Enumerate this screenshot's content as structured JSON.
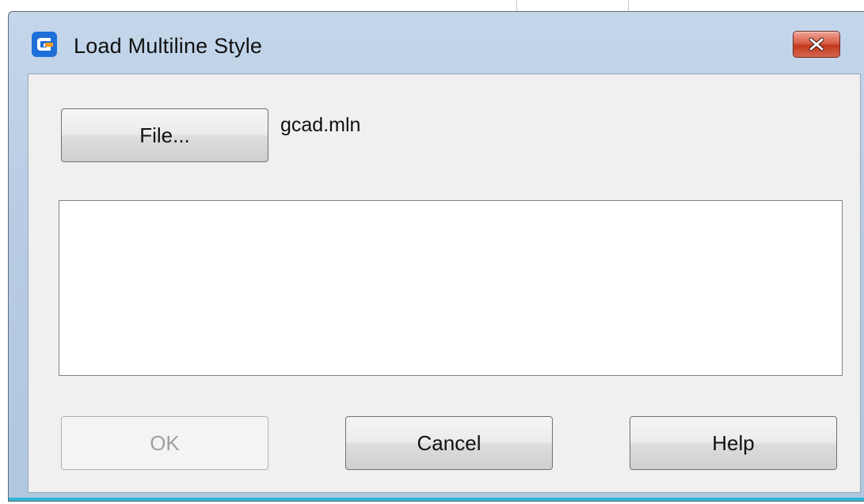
{
  "dialog": {
    "title": "Load Multiline Style",
    "app_icon": "gcad-logo-icon",
    "close_icon": "close-icon",
    "file_button_label": "File...",
    "file_name": "gcad.mln",
    "styles_list": [],
    "buttons": {
      "ok_label": "OK",
      "ok_enabled": false,
      "cancel_label": "Cancel",
      "help_label": "Help"
    }
  },
  "colors": {
    "titlebar": "#b8cde4",
    "close_button": "#d6533b",
    "client_background": "#f0f0f0",
    "app_icon_blue": "#1f6fd8",
    "app_icon_orange": "#f39a1e"
  }
}
